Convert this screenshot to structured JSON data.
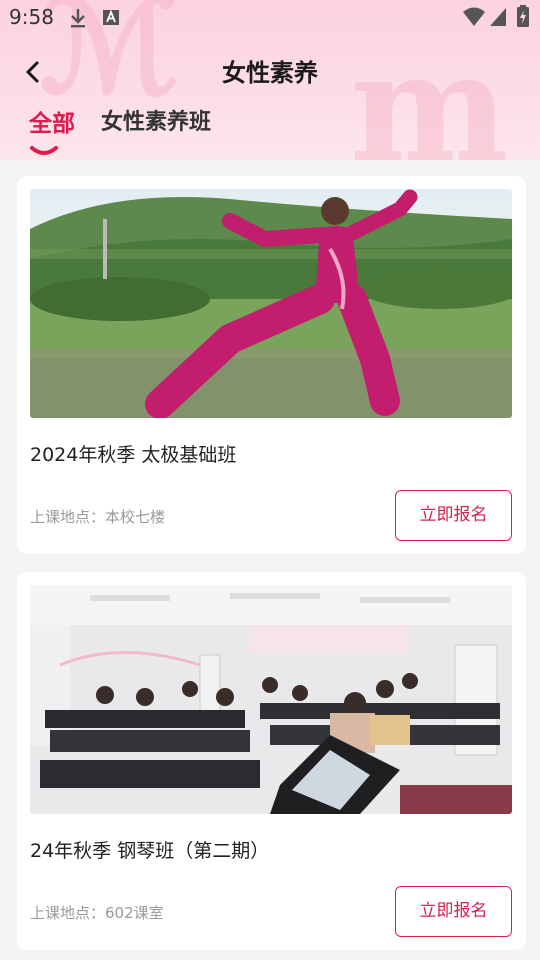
{
  "status_bar": {
    "time": "9:58",
    "icons": [
      "download-icon",
      "font-app-icon",
      "wifi-icon",
      "signal-icon",
      "battery-charging-icon"
    ]
  },
  "header": {
    "back_icon": "chevron-left-icon",
    "title": "女性素养"
  },
  "tabs": [
    {
      "label": "全部",
      "active": true
    },
    {
      "label": "女性素养班",
      "active": false
    }
  ],
  "colors": {
    "accent": "#e0194f",
    "header_bg": "#fbd3df",
    "page_bg": "#f4f4f6"
  },
  "courses": [
    {
      "title": "2024年秋季 太极基础班",
      "location": "上课地点：本校七楼",
      "button_label": "立即报名",
      "image": "woman-tai-chi-by-pond-photo"
    },
    {
      "title": "24年秋季 钢琴班（第二期）",
      "location": "上课地点：602课室",
      "button_label": "立即报名",
      "image": "piano-classroom-photo"
    }
  ]
}
